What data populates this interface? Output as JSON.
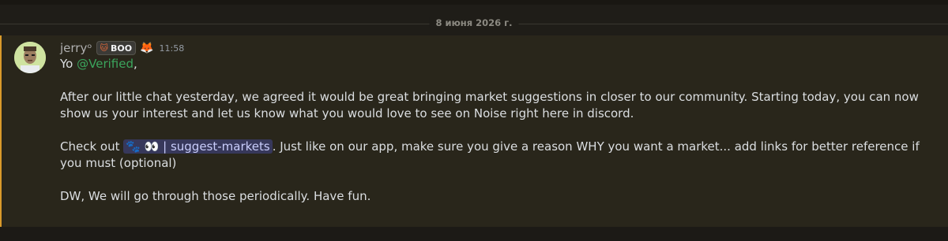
{
  "date_divider": "8 июня 2026 г.",
  "message": {
    "author": "jerryᵒ",
    "tag_label": "BOO",
    "timestamp": "11:58",
    "line1_prefix": "Yo ",
    "mention": "@Verified",
    "line1_suffix": ",",
    "paragraph2": "After our little chat yesterday, we agreed it would be great bringing market suggestions in closer to our community. Starting today, you can now show us your interest and let us know what you would love to see on Noise right here in discord.",
    "para3_prefix": "Check out ",
    "channel_emoji": "🐾 👀",
    "channel_sep": " | ",
    "channel_name": "suggest-markets",
    "para3_suffix": ". Just like on our app, make sure you give a reason WHY you want a market... add links for better reference if you must (optional)",
    "paragraph4": "DW, We will go through those periodically. Have fun."
  },
  "colors": {
    "accent_border": "#d99a2b",
    "mention": "#3ba55d",
    "channel_pill_text": "#c9cdfb"
  }
}
